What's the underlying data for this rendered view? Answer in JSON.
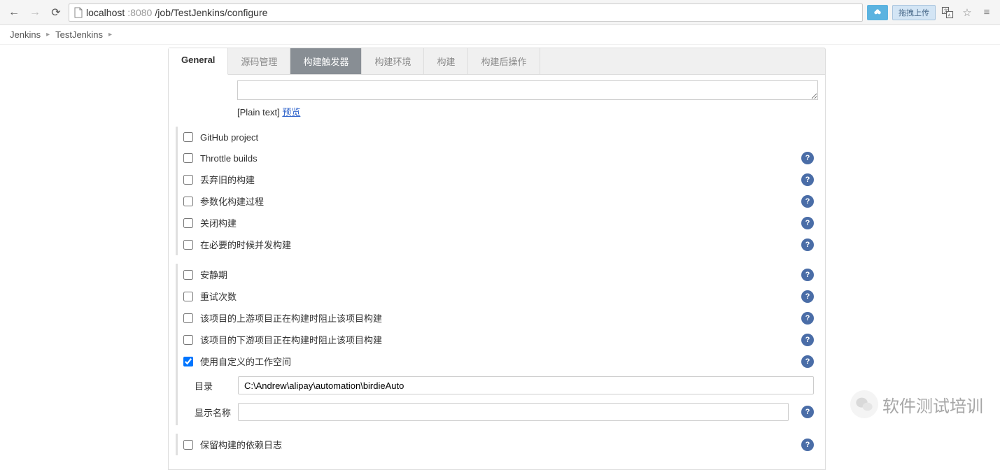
{
  "browser": {
    "url_host": "localhost",
    "url_port": ":8080",
    "url_path": "/job/TestJenkins/configure",
    "ext_upload": "拖拽上传"
  },
  "breadcrumb": {
    "items": [
      "Jenkins",
      "TestJenkins"
    ]
  },
  "tabs": {
    "general": "General",
    "scm": "源码管理",
    "triggers": "构建触发器",
    "env": "构建环境",
    "build": "构建",
    "post": "构建后操作"
  },
  "desc": {
    "plain_text": "[Plain text]",
    "preview": "预览"
  },
  "section1": {
    "github_project": "GitHub project",
    "throttle_builds": "Throttle builds",
    "discard_old": "丢弃旧的构建",
    "parameterized": "参数化构建过程",
    "disable_build": "关闭构建",
    "concurrent": "在必要的时候并发构建"
  },
  "section2": {
    "quiet_period": "安静期",
    "retry_count": "重试次数",
    "block_upstream": "该项目的上游项目正在构建时阻止该项目构建",
    "block_downstream": "该项目的下游项目正在构建时阻止该项目构建",
    "custom_workspace": "使用自定义的工作空间",
    "dir_label": "目录",
    "dir_value": "C:\\Andrew\\alipay\\automation\\birdieAuto",
    "display_name_label": "显示名称",
    "display_name_value": ""
  },
  "section3": {
    "keep_deps": "保留构建的依赖日志"
  },
  "watermark": {
    "text": "软件测试培训"
  }
}
